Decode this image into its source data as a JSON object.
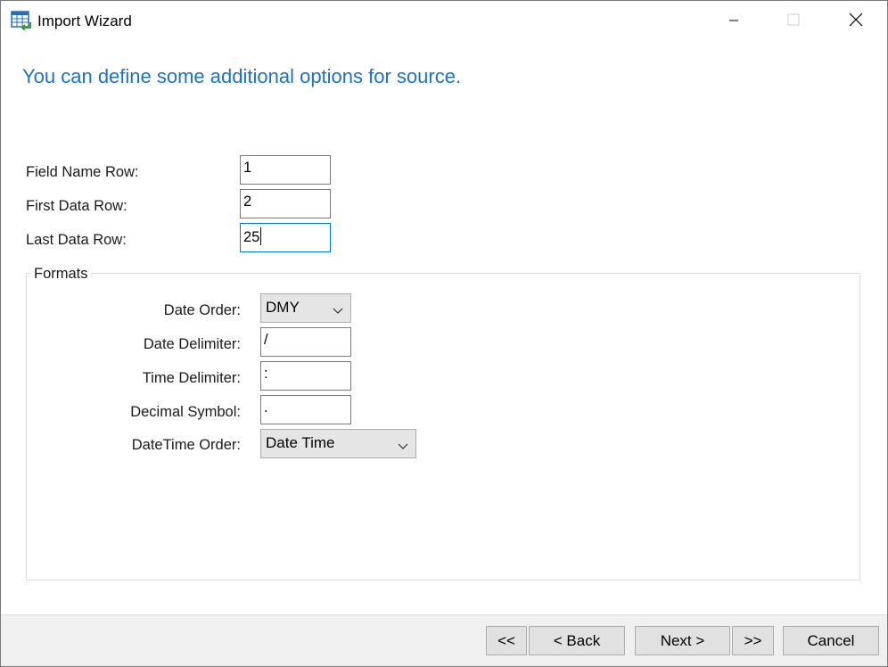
{
  "window": {
    "title": "Import Wizard"
  },
  "heading": "You can define some additional options for source.",
  "rows": {
    "field_name_row": {
      "label": "Field Name Row:",
      "value": "1"
    },
    "first_data_row": {
      "label": "First Data Row:",
      "value": "2"
    },
    "last_data_row": {
      "label": "Last Data Row:",
      "value": "25"
    }
  },
  "formats": {
    "title": "Formats",
    "date_order": {
      "label": "Date Order:",
      "value": "DMY"
    },
    "date_delimiter": {
      "label": "Date Delimiter:",
      "value": "/"
    },
    "time_delimiter": {
      "label": "Time Delimiter:",
      "value": ":"
    },
    "decimal_symbol": {
      "label": "Decimal Symbol:",
      "value": "."
    },
    "datetime_order": {
      "label": "DateTime Order:",
      "value": "Date Time"
    }
  },
  "footer": {
    "first_label": "<<",
    "back_label": "< Back",
    "next_label": "Next >",
    "last_label": ">>",
    "cancel_label": "Cancel"
  },
  "colors": {
    "heading": "#1e73be",
    "focus_border": "#0078d7",
    "footer_bg": "#f0f0f0"
  },
  "icons": {
    "app": "table-import-icon",
    "minimize": "minimize-icon",
    "maximize": "maximize-icon",
    "close": "close-icon",
    "dropdown": "chevron-down-icon"
  }
}
